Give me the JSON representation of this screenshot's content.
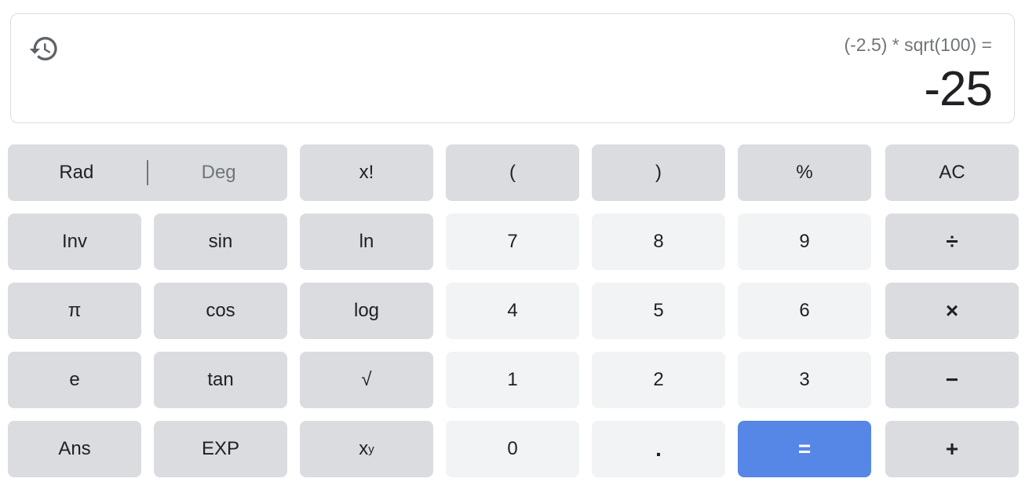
{
  "display": {
    "history_icon": "history-icon",
    "expression": "(-2.5) * sqrt(100) =",
    "result": "-25"
  },
  "mode": {
    "rad_label": "Rad",
    "deg_label": "Deg",
    "active": "Rad"
  },
  "colors": {
    "function_key_bg": "#dadce0",
    "number_key_bg": "#f1f3f4",
    "equals_key_bg": "#5686e6",
    "text": "#202124",
    "muted_text": "#70757a"
  },
  "keys": {
    "factorial": "x!",
    "open_paren": "(",
    "close_paren": ")",
    "percent": "%",
    "all_clear": "AC",
    "inv": "Inv",
    "sin": "sin",
    "ln": "ln",
    "seven": "7",
    "eight": "8",
    "nine": "9",
    "divide": "÷",
    "pi": "π",
    "cos": "cos",
    "log": "log",
    "four": "4",
    "five": "5",
    "six": "6",
    "multiply": "×",
    "e": "e",
    "tan": "tan",
    "sqrt": "√",
    "one": "1",
    "two": "2",
    "three": "3",
    "minus": "−",
    "ans": "Ans",
    "exp": "EXP",
    "power_base": "x",
    "power_exp": "y",
    "zero": "0",
    "decimal": ".",
    "equals": "=",
    "plus": "+"
  }
}
